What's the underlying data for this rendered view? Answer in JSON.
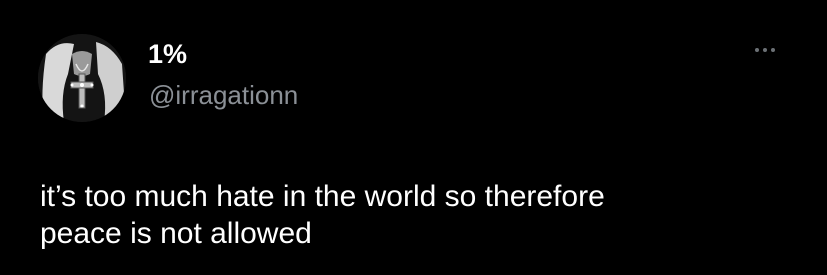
{
  "author": {
    "display_name": "1%",
    "handle": "@irragationn",
    "avatar_icon": "profile-photo-cross-necklace"
  },
  "actions": {
    "more_icon": "more-horizontal-icon"
  },
  "tweet": {
    "lines": [
      "it’s too much hate in the world so therefore",
      "peace is not allowed"
    ]
  },
  "colors": {
    "background": "#000000",
    "text_primary": "#ffffff",
    "text_secondary": "#8b9096"
  }
}
